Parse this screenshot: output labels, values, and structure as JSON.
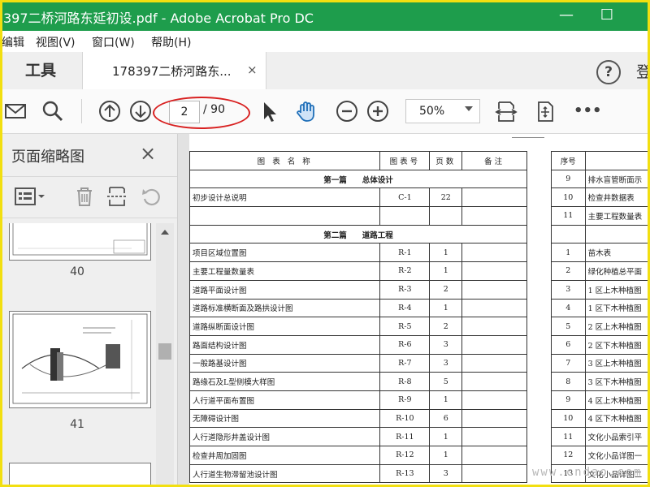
{
  "window": {
    "title": "397二桥河路东延初设.pdf - Adobe Acrobat Pro DC",
    "minimize": "—",
    "maximize": "☐"
  },
  "menu": [
    "编辑",
    "视图(V)",
    "窗口(W)",
    "帮助(H)"
  ],
  "tabs": {
    "tools": "工具",
    "document": "178397二桥河路东...",
    "close": "×",
    "help": "?",
    "login": "登"
  },
  "toolbar": {
    "page_current": "2",
    "page_total": "/ 90",
    "zoom": "50%",
    "more": "•••"
  },
  "panel": {
    "title": "页面缩略图",
    "close": "×",
    "thumbnails": [
      {
        "label": "40"
      },
      {
        "label": "41"
      }
    ]
  },
  "index_table": {
    "headers": [
      "图 表 名 称",
      "图表号",
      "页数",
      "备注"
    ],
    "sections": [
      {
        "title": "第一篇　　总体设计",
        "rows": [
          [
            "初步设计总说明",
            "C-1",
            "22",
            ""
          ],
          [
            "",
            "",
            "",
            ""
          ]
        ]
      },
      {
        "title": "第二篇　　道路工程",
        "rows": [
          [
            "项目区域位置图",
            "R-1",
            "1",
            ""
          ],
          [
            "主要工程量数量表",
            "R-2",
            "1",
            ""
          ],
          [
            "道路平面设计图",
            "R-3",
            "2",
            ""
          ],
          [
            "道路标准横断面及路拱设计图",
            "R-4",
            "1",
            ""
          ],
          [
            "道路纵断面设计图",
            "R-5",
            "2",
            ""
          ],
          [
            "路面结构设计图",
            "R-6",
            "3",
            ""
          ],
          [
            "一般路基设计图",
            "R-7",
            "3",
            ""
          ],
          [
            "路缘石及L型侧模大样图",
            "R-8",
            "5",
            ""
          ],
          [
            "人行道平面布置图",
            "R-9",
            "1",
            ""
          ],
          [
            "无障碍设计图",
            "R-10",
            "6",
            ""
          ],
          [
            "人行道隐形井盖设计图",
            "R-11",
            "1",
            ""
          ],
          [
            "检查井周加固图",
            "R-12",
            "1",
            ""
          ],
          [
            "人行道生物滞留池设计图",
            "R-13",
            "3",
            ""
          ]
        ]
      }
    ]
  },
  "right_table": {
    "header": "序号",
    "rows": [
      [
        "9",
        "排水盲管断面示"
      ],
      [
        "10",
        "检查井数据表"
      ],
      [
        "11",
        "主要工程数量表"
      ],
      [
        "",
        ""
      ],
      [
        "1",
        "苗木表"
      ],
      [
        "2",
        "绿化种植总平面"
      ],
      [
        "3",
        "1 区上木种植图"
      ],
      [
        "4",
        "1 区下木种植图"
      ],
      [
        "5",
        "2 区上木种植图"
      ],
      [
        "6",
        "2 区下木种植图"
      ],
      [
        "7",
        "3 区上木种植图"
      ],
      [
        "8",
        "3 区下木种植图"
      ],
      [
        "9",
        "4 区上木种植图"
      ],
      [
        "10",
        "4 区下木种植图"
      ],
      [
        "11",
        "文化小品索引平"
      ],
      [
        "12",
        "文化小品详图一"
      ],
      [
        "13",
        "文化小品详图二"
      ]
    ]
  },
  "watermark": "www.cndao.com"
}
